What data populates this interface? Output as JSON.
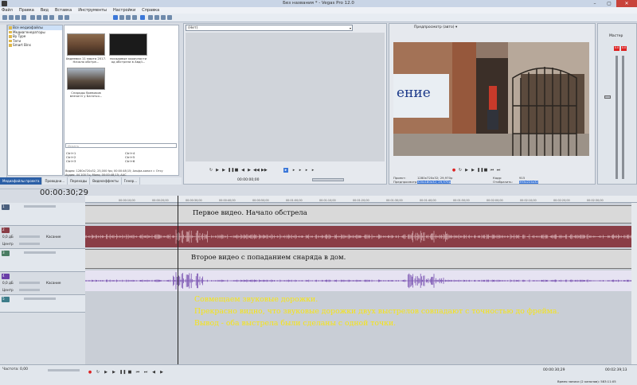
{
  "window": {
    "title": "Без названия * - Vegas Pro 12.0",
    "controls": [
      "–",
      "▢",
      "✕"
    ]
  },
  "menu": [
    "Файл",
    "Правка",
    "Вид",
    "Вставка",
    "Инструменты",
    "Настройки",
    "Справка"
  ],
  "explorer": {
    "tree": [
      "Все медиафайлы",
      "Медиагенераторы",
      "By Type",
      "Теги",
      "Smart Bins"
    ],
    "media": [
      {
        "caption": "Авдеевка 11 марта 2017. Начало обстре..."
      },
      {
        "caption": "посадовые корочности од обстрели в Авдії..."
      },
      {
        "caption": "Снаряды боевиков впечатл у Багатья..."
      }
    ],
    "search_placeholder": "Искать",
    "shortcuts": [
      "Ctrl+1",
      "Ctrl+4",
      "Ctrl+2",
      "Ctrl+5",
      "Ctrl+3",
      "Ctrl+6"
    ],
    "info_video": "Видео: 1280x720x32, 25,000 fps; 00:00:48;15; Альфа-канал = Отсу",
    "info_audio": "Аудио: 44 100 Гц; Моно; 00:00:48;15; AAC"
  },
  "tabs": [
    "Медиафайлы проекта",
    "Проводни...",
    "Переходы",
    "Видеоэффекты",
    "Генер..."
  ],
  "trimmer": {
    "source": "(Нет)",
    "timecode": "00:00:00;00"
  },
  "preview": {
    "mode": "Предпросмотр (авто)",
    "video_text": "ение",
    "project_label": "Проект:",
    "project_value": "1280x720x32; 29,970p",
    "preview_label": "Предпросмотр:",
    "preview_value": "320x180x32; 29,970p",
    "frame_label": "Кадр:",
    "frame_value": "915",
    "display_label": "Отобразить:",
    "display_value": "393x224x32"
  },
  "mixer": {
    "title": "Мастер",
    "left_level": "0.0",
    "right_level": "0.0"
  },
  "timeline": {
    "timecode": "00:00:30;29",
    "ruler": [
      "00:00:00;00",
      "00:00:10;00",
      "00:00:20;00",
      "00:00:30;00",
      "00:00:40;00",
      "00:00:50;00",
      "00:01:00;00",
      "00:01:10;00",
      "00:01:20;00",
      "00:01:30;00",
      "00:01:40;00",
      "00:01:50;00",
      "00:02:00;00",
      "00:02:10;00",
      "00:02:20;00",
      "00:02:30;00",
      "00:02:40;00"
    ],
    "tracks": [
      {
        "type": "video",
        "num": "1"
      },
      {
        "type": "audio",
        "num": "2",
        "level": "0,0 дБ",
        "pan": "Центр",
        "mode": "Касание"
      },
      {
        "type": "video",
        "num": "3"
      },
      {
        "type": "audio",
        "num": "4",
        "level": "0,0 дБ",
        "pan": "Центр",
        "mode": "Касание"
      },
      {
        "type": "video",
        "num": "5"
      }
    ],
    "clip1_text": "Первое видео. Начало обстрела",
    "clip2_text": "Второе видео с попаданием снаряда в дом.",
    "annotation": [
      "Совмещаем звуковые дорожки.",
      "Прекрасно видно, что звуковые дорожки двух выстрелов совпадают с точностью до фрейма.",
      "Вывод - оба выстрела были сделаны с одной точки."
    ]
  },
  "bottom": {
    "rate_label": "Частота: 0,00",
    "time1": "00:00:30;29",
    "time2": "00:02:39;13",
    "status": "Время записи (2 каналов): 583:11:05"
  },
  "colors": {
    "audio1": "#8a3d46",
    "audio2": "#e6e3f2",
    "wave2": "#6a3fa8",
    "annotation": "#f6e417"
  }
}
